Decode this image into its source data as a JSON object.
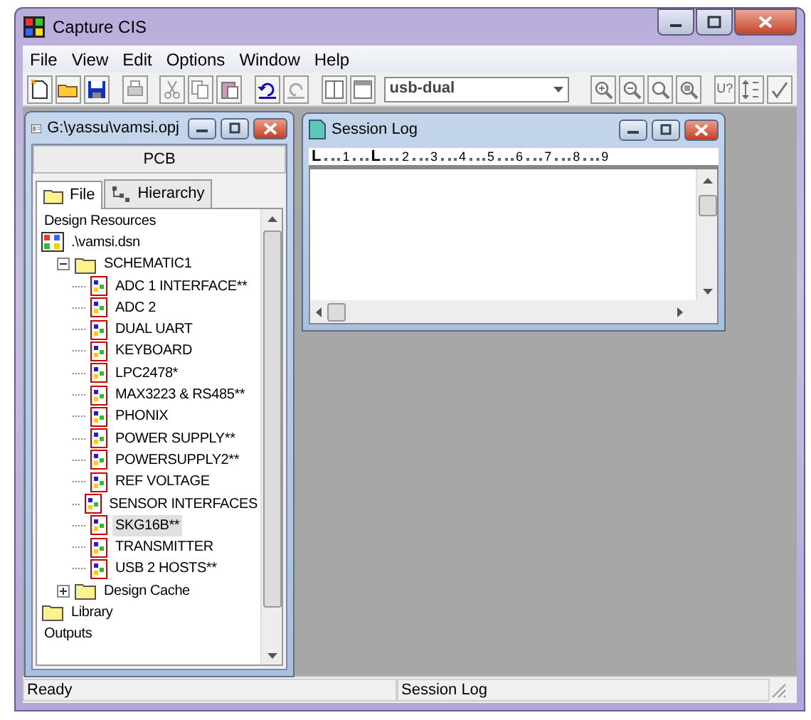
{
  "window": {
    "title": "Capture CIS"
  },
  "menu": [
    "File",
    "View",
    "Edit",
    "Options",
    "Window",
    "Help"
  ],
  "toolbar": {
    "design_combo": "usb-dual",
    "part_ref_label": "U?"
  },
  "project_window": {
    "title": "G:\\yassu\\vamsi.opj",
    "header": "PCB",
    "tabs": [
      {
        "label": "File",
        "selected": true,
        "kind": "folder"
      },
      {
        "label": "Hierarchy",
        "selected": false,
        "kind": "hierarchy"
      }
    ],
    "tree": [
      {
        "kind": "label",
        "label": "Design Resources",
        "children": [
          {
            "kind": "design",
            "label": ".\\vamsi.dsn",
            "children": [
              {
                "kind": "folder",
                "label": "SCHEMATIC1",
                "expanded": true,
                "children": [
                  {
                    "kind": "page",
                    "label": "ADC 1 INTERFACE**",
                    "selected": false
                  },
                  {
                    "kind": "page",
                    "label": "ADC 2",
                    "selected": false
                  },
                  {
                    "kind": "page",
                    "label": "DUAL UART",
                    "selected": false
                  },
                  {
                    "kind": "page",
                    "label": "KEYBOARD",
                    "selected": false
                  },
                  {
                    "kind": "page",
                    "label": "LPC2478*",
                    "selected": false
                  },
                  {
                    "kind": "page",
                    "label": "MAX3223 & RS485**",
                    "selected": false
                  },
                  {
                    "kind": "page",
                    "label": "PHONIX",
                    "selected": false
                  },
                  {
                    "kind": "page",
                    "label": "POWER SUPPLY**",
                    "selected": false
                  },
                  {
                    "kind": "page",
                    "label": "POWERSUPPLY2**",
                    "selected": false
                  },
                  {
                    "kind": "page",
                    "label": "REF VOLTAGE",
                    "selected": false
                  },
                  {
                    "kind": "page",
                    "label": "SENSOR  INTERFACES",
                    "selected": false
                  },
                  {
                    "kind": "page",
                    "label": "SKG16B**",
                    "selected": true
                  },
                  {
                    "kind": "page",
                    "label": "TRANSMITTER",
                    "selected": false
                  },
                  {
                    "kind": "page",
                    "label": "USB 2 HOSTS**",
                    "selected": false
                  }
                ]
              },
              {
                "kind": "folder",
                "label": "Design Cache",
                "expanded": false
              }
            ]
          },
          {
            "kind": "folder",
            "label": "Library"
          },
          {
            "kind": "label",
            "label": "Outputs"
          }
        ]
      }
    ]
  },
  "session_log": {
    "title": "Session Log",
    "ruler": [
      {
        "kind": "tab",
        "text": "L"
      },
      {
        "kind": "number",
        "text": "1"
      },
      {
        "kind": "tab",
        "text": "L"
      },
      {
        "kind": "number",
        "text": "2"
      },
      {
        "kind": "number",
        "text": "3"
      },
      {
        "kind": "number",
        "text": "4"
      },
      {
        "kind": "number",
        "text": "5"
      },
      {
        "kind": "number",
        "text": "6"
      },
      {
        "kind": "number",
        "text": "7"
      },
      {
        "kind": "number",
        "text": "8"
      },
      {
        "kind": "number",
        "text": "9"
      }
    ]
  },
  "status_bar": [
    "Ready",
    "Session Log"
  ]
}
